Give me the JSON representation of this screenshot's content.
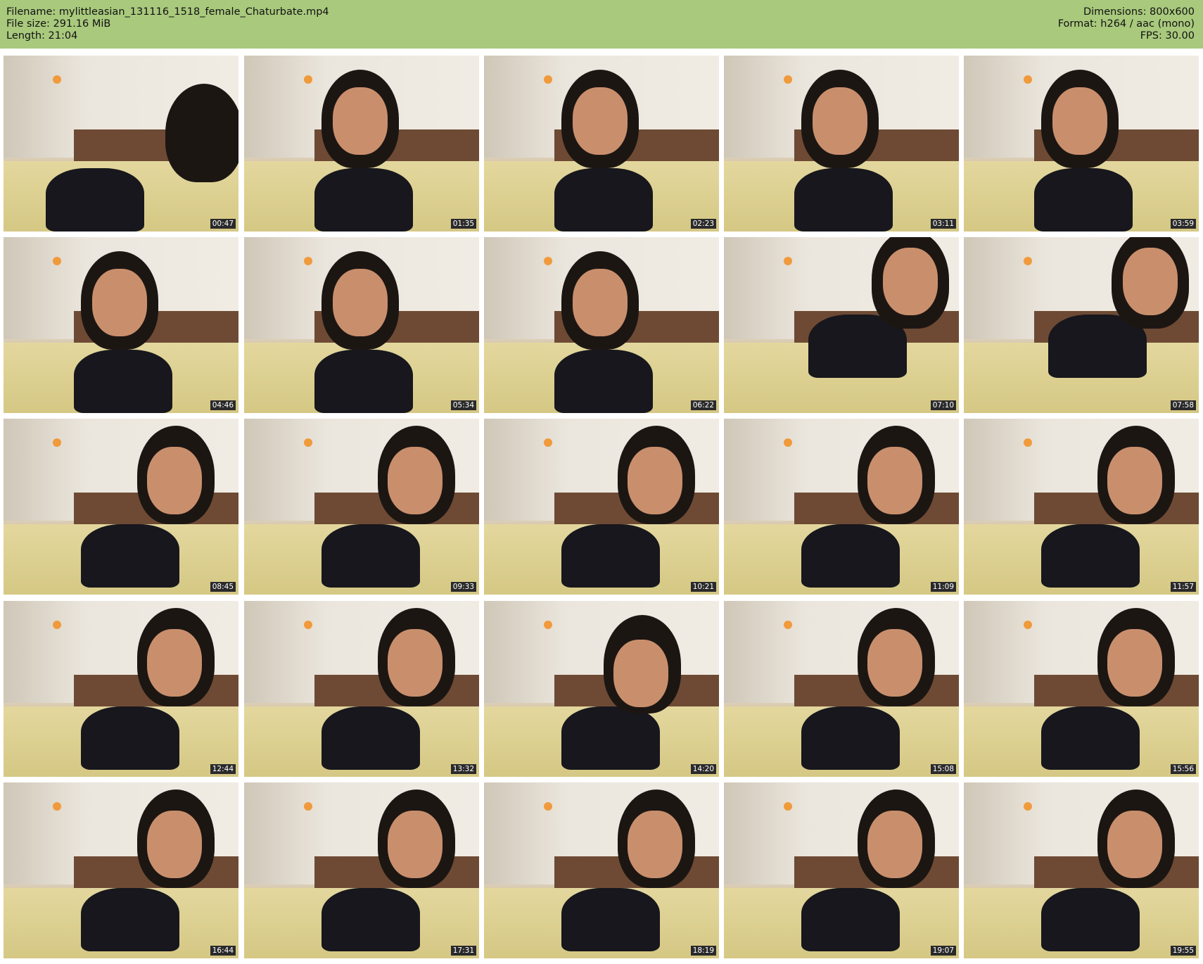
{
  "header": {
    "filename": "Filename: mylittleasian_131116_1518_female_Chaturbate.mp4",
    "filesize": "File size: 291.16 MiB",
    "length": "Length: 21:04",
    "dimensions": "Dimensions: 800x600",
    "format": "Format: h264 / aac (mono)",
    "fps": "FPS: 30.00"
  },
  "thumbnails": [
    {
      "timestamp": "00:47",
      "pose": "lying-far"
    },
    {
      "timestamp": "01:35",
      "pose": "front"
    },
    {
      "timestamp": "02:23",
      "pose": "front"
    },
    {
      "timestamp": "03:11",
      "pose": "front"
    },
    {
      "timestamp": "03:59",
      "pose": "front"
    },
    {
      "timestamp": "04:46",
      "pose": "front"
    },
    {
      "timestamp": "05:34",
      "pose": "front"
    },
    {
      "timestamp": "06:22",
      "pose": "front"
    },
    {
      "timestamp": "07:10",
      "pose": "side-right"
    },
    {
      "timestamp": "07:58",
      "pose": "side-right"
    },
    {
      "timestamp": "08:45",
      "pose": "reclined"
    },
    {
      "timestamp": "09:33",
      "pose": "reclined"
    },
    {
      "timestamp": "10:21",
      "pose": "reclined"
    },
    {
      "timestamp": "11:09",
      "pose": "reclined"
    },
    {
      "timestamp": "11:57",
      "pose": "reclined"
    },
    {
      "timestamp": "12:44",
      "pose": "reclined"
    },
    {
      "timestamp": "13:32",
      "pose": "reclined"
    },
    {
      "timestamp": "14:20",
      "pose": "looking-down"
    },
    {
      "timestamp": "15:08",
      "pose": "reclined"
    },
    {
      "timestamp": "15:56",
      "pose": "reclined"
    },
    {
      "timestamp": "16:44",
      "pose": "reclined"
    },
    {
      "timestamp": "17:31",
      "pose": "reclined"
    },
    {
      "timestamp": "18:19",
      "pose": "reclined"
    },
    {
      "timestamp": "19:07",
      "pose": "reclined"
    },
    {
      "timestamp": "19:55",
      "pose": "reclined"
    }
  ]
}
